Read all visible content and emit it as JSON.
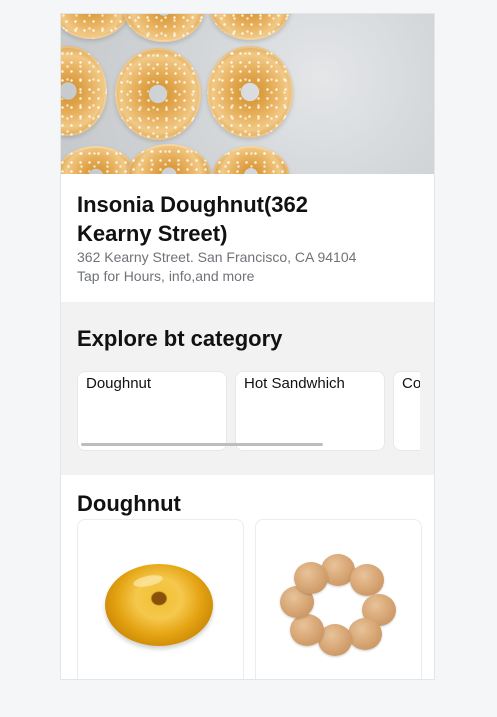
{
  "store": {
    "name": "Insonia Doughnut(362 Kearny Street)",
    "address": "362 Kearny Street. San Francisco, CA 94104",
    "more_info": "Tap for Hours, info,and more"
  },
  "explore": {
    "title": "Explore bt category",
    "categories": [
      {
        "label": "Doughnut"
      },
      {
        "label": "Hot Sandwhich"
      },
      {
        "label": "Co"
      }
    ]
  },
  "section": {
    "title": "Doughnut"
  },
  "products": [
    {
      "image": "glazed-doughnut-image"
    },
    {
      "image": "pon-de-ring-doughnut-image"
    }
  ]
}
